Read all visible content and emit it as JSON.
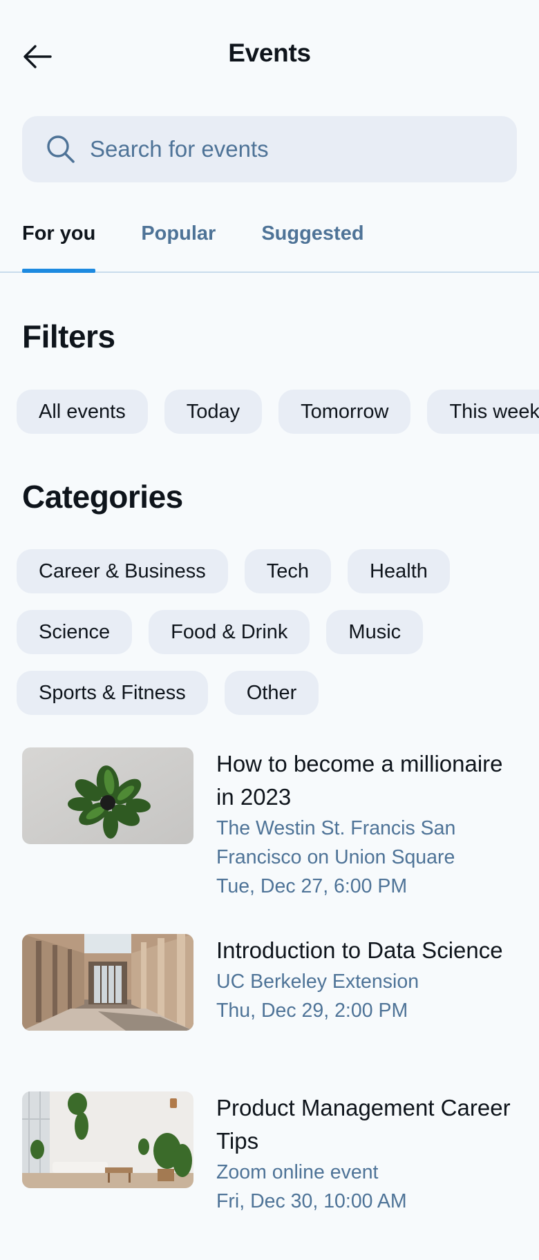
{
  "header": {
    "title": "Events",
    "back_icon": "arrow-left-icon"
  },
  "search": {
    "placeholder": "Search for events",
    "value": "",
    "icon": "search-icon"
  },
  "tabs": [
    {
      "label": "For you",
      "active": true
    },
    {
      "label": "Popular",
      "active": false
    },
    {
      "label": "Suggested",
      "active": false
    }
  ],
  "filters": {
    "title": "Filters",
    "items": [
      "All events",
      "Today",
      "Tomorrow",
      "This week"
    ]
  },
  "categories": {
    "title": "Categories",
    "items": [
      "Career & Business",
      "Tech",
      "Health",
      "Science",
      "Food & Drink",
      "Music",
      "Sports & Fitness",
      "Other"
    ]
  },
  "events": [
    {
      "title": "How to become a millionaire in 2023",
      "location": "The Westin St. Francis San Francisco on Union Square",
      "datetime": "Tue, Dec 27, 6:00 PM"
    },
    {
      "title": "Introduction to Data Science",
      "location": "UC Berkeley Extension",
      "datetime": "Thu, Dec 29, 2:00 PM"
    },
    {
      "title": "Product Management Career Tips",
      "location": "Zoom online event",
      "datetime": "Fri, Dec 30, 10:00 AM"
    }
  ],
  "colors": {
    "background": "#f7fafc",
    "chip": "#e8edf5",
    "accent": "#1d8ae0",
    "secondary_text": "#4e7397",
    "primary_text": "#0e141b"
  }
}
